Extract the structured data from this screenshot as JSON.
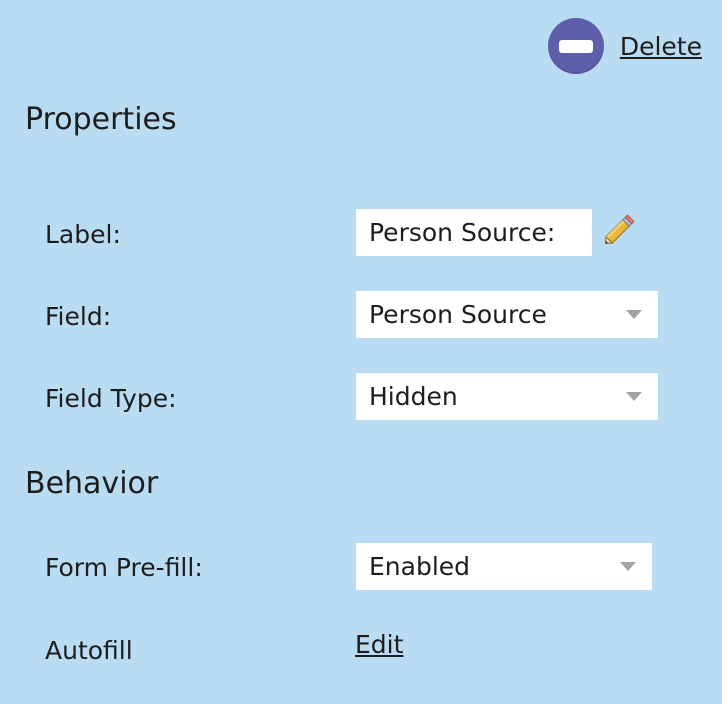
{
  "header": {
    "delete_label": "Delete"
  },
  "properties": {
    "title": "Properties",
    "label_caption": "Label:",
    "label_value": "Person Source:",
    "field_caption": "Field:",
    "field_value": "Person Source",
    "field_type_caption": "Field Type:",
    "field_type_value": "Hidden"
  },
  "behavior": {
    "title": "Behavior",
    "prefill_caption": "Form Pre-fill:",
    "prefill_value": "Enabled",
    "autofill_caption": "Autofill",
    "autofill_link": "Edit"
  },
  "icons": {
    "delete": "minus-circle-icon",
    "edit": "pencil-icon",
    "dropdown": "chevron-down-icon"
  },
  "colors": {
    "background": "#b9dcf2",
    "delete_icon": "#5d5fab",
    "input_bg": "#ffffff"
  }
}
